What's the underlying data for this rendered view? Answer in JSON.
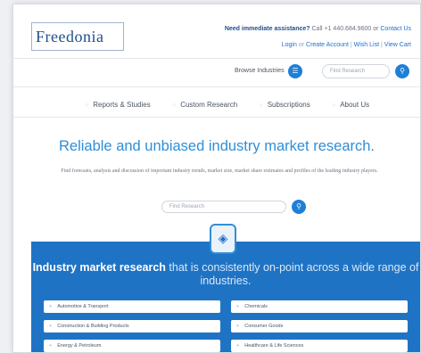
{
  "header": {
    "logo_text": "Freedonia",
    "help_strong": "Need immediate assistance?",
    "help_call": "Call +1 440.684.9600 or",
    "help_contact": "Contact Us",
    "login": "Login",
    "or": "or",
    "create_account": "Create Account",
    "wish_list": "Wish List",
    "view_cart": "View Cart",
    "sep": "|"
  },
  "toolbar": {
    "browse_label": "Browse Industries",
    "search_placeholder": "Find Research"
  },
  "nav": {
    "items": [
      "Reports & Studies",
      "Custom Research",
      "Subscriptions",
      "About Us"
    ]
  },
  "hero": {
    "title": "Reliable and unbiased industry market research.",
    "subtitle": "Find forecasts, analysis and discussion of important industry trends, market size, market share estimates and profiles of the leading industry players.",
    "search_placeholder": "Find Research"
  },
  "industries": {
    "title_bold": "Industry market research",
    "title_rest": " that is consistently on-point across a wide range of industries.",
    "items": [
      "Automotive & Transport",
      "Chemicals",
      "Construction & Building Products",
      "Consumer Goods",
      "Energy & Petroleum",
      "Healthcare & Life Sciences"
    ]
  },
  "colors": {
    "brand_blue": "#1f73c4",
    "accent_blue": "#2f8ed8",
    "button_blue": "#1f7fd6"
  }
}
